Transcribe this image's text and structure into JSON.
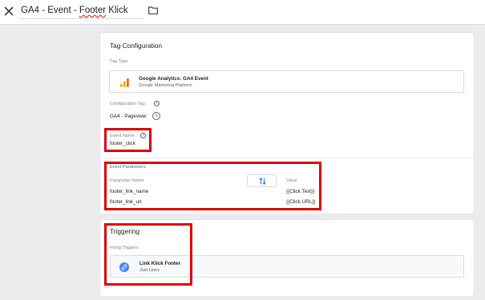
{
  "header": {
    "title_prefix": "GA4 - Event - ",
    "title_spell": "Footer",
    "title_suffix": " Klick",
    "close_icon": "close-icon",
    "folder_icon": "folder-icon"
  },
  "tag_configuration": {
    "title": "Tag Configuration",
    "tag_type_label": "Tag Type",
    "tag_type_name": "Google Analytics: GA4 Event",
    "tag_type_platform": "Google Marketing Platform",
    "config_tag_label": "Configuration Tag",
    "config_tag_value": "GA4 - Pageview",
    "event_name_label": "Event Name",
    "event_name_value": "footer_click",
    "event_params_title": "Event Parameters",
    "param_name_header": "Parameter Name",
    "value_header": "Value",
    "params": [
      {
        "name": "footer_link_name",
        "value": "{{Click Text}}"
      },
      {
        "name": "footer_link_url",
        "value": "{{Click URL}}"
      }
    ]
  },
  "triggering": {
    "title": "Triggering",
    "firing_label": "Firing Triggers",
    "trigger_name": "Link Klick Footer",
    "trigger_type": "Just Links"
  },
  "colors": {
    "highlight": "#e00000",
    "ga_bar_dark": "#e37400",
    "ga_bar_light": "#f9ab00",
    "link_icon": "#4285f4"
  }
}
